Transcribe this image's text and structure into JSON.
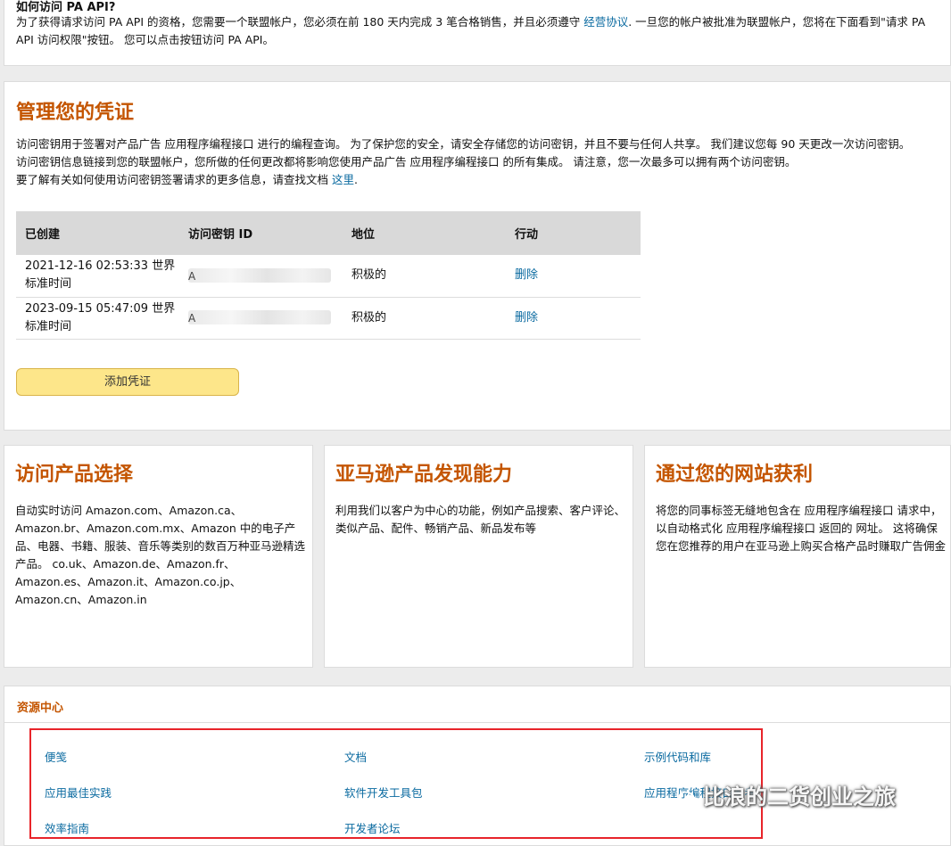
{
  "intro": {
    "question": "如何访问 PA API?",
    "text_before": "为了获得请求访问 PA API 的资格，您需要一个联盟帐户，您必须在前 180 天内完成 3 笔合格销售，并且必须遵守",
    "link": "经营协议",
    "text_after": ". 一旦您的帐户被批准为联盟帐户，您将在下面看到\"请求 PA API 访问权限\"按钮。 您可以点击按钮访问 PA API。"
  },
  "credentials": {
    "title": "管理您的凭证",
    "line1": "访问密钥用于签署对产品广告 应用程序编程接口 进行的编程查询。 为了保护您的安全，请安全存储您的访问密钥，并且不要与任何人共享。 我们建议您每 90 天更改一次访问密钥。",
    "line2": "访问密钥信息链接到您的联盟帐户，您所做的任何更改都将影响您使用产品广告 应用程序编程接口 的所有集成。 请注意，您一次最多可以拥有两个访问密钥。",
    "line3_before": "要了解有关如何使用访问密钥签署请求的更多信息，请查找文档",
    "line3_link": "这里",
    "line3_after": ".",
    "table": {
      "headers": [
        "已创建",
        "访问密钥 ID",
        "地位",
        "行动"
      ],
      "rows": [
        {
          "created": "2021-12-16 02:53:33 世界标准时间",
          "key_id": "A",
          "status": "积极的",
          "action": "删除"
        },
        {
          "created": "2023-09-15 05:47:09 世界标准时间",
          "key_id": "A",
          "status": "积极的",
          "action": "删除"
        }
      ]
    },
    "add_button": "添加凭证"
  },
  "cards": [
    {
      "title": "访问产品选择",
      "text": "自动实时访问 Amazon.com、Amazon.ca、Amazon.br、Amazon.com.mx、Amazon 中的电子产品、电器、书籍、服装、音乐等类别的数百万种亚马逊精选产品。 co.uk、Amazon.de、Amazon.fr、Amazon.es、Amazon.it、Amazon.co.jp、Amazon.cn、Amazon.in"
    },
    {
      "title": "亚马逊产品发现能力",
      "text": "利用我们以客户为中心的功能，例如产品搜索、客户评论、类似产品、配件、畅销产品、新品发布等"
    },
    {
      "title": "通过您的网站获利",
      "text": "将您的同事标签无缝地包含在 应用程序编程接口 请求中，以自动格式化 应用程序编程接口 返回的 网址。 这将确保您在您推荐的用户在亚马逊上购买合格产品时赚取广告佣金"
    }
  ],
  "resources": {
    "title": "资源中心",
    "links": [
      [
        "便笺",
        "文档",
        "示例代码和库"
      ],
      [
        "应用最佳实践",
        "软件开发工具包",
        "应用程序编程接口参考"
      ],
      [
        "效率指南",
        "开发者论坛",
        ""
      ]
    ]
  },
  "watermark": "比浪的二货创业之旅",
  "colors": {
    "accent": "#c45500",
    "link": "#0a6aa0",
    "button": "#fde68a",
    "highlight_box": "#e8242a"
  }
}
